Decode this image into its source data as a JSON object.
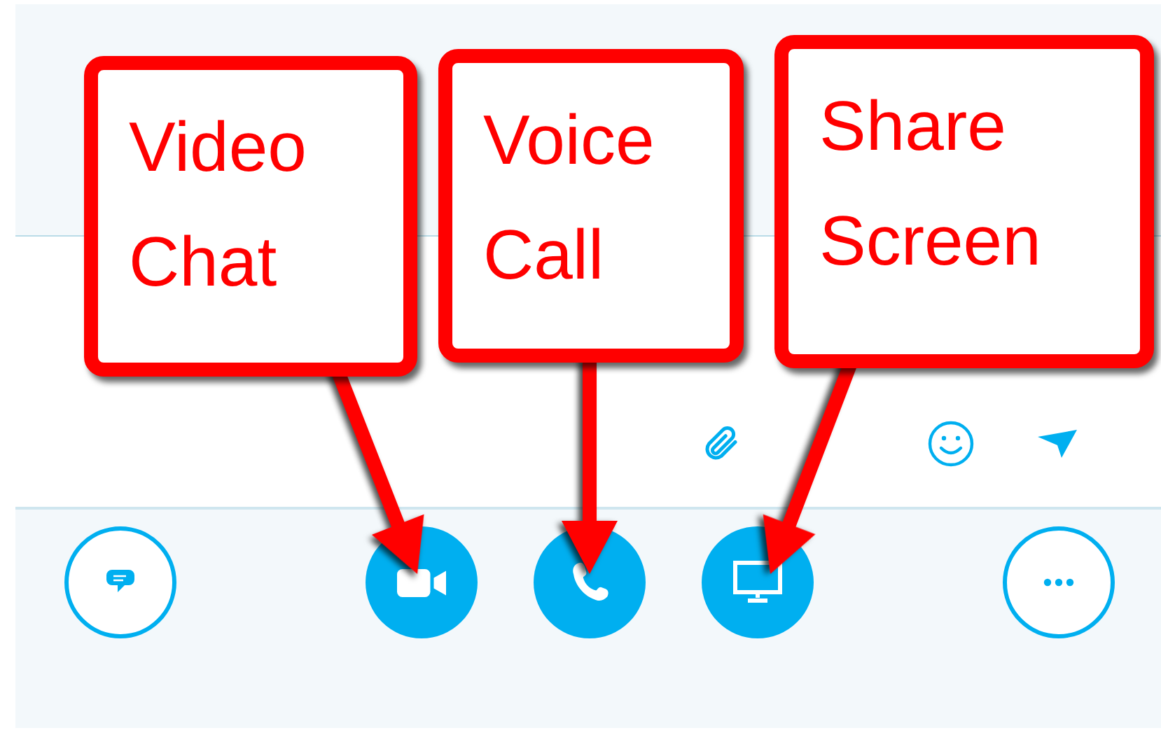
{
  "callouts": [
    {
      "text": "Video Chat"
    },
    {
      "text": "Voice Call"
    },
    {
      "text": "Share Screen"
    }
  ],
  "compose_tools": [
    {
      "kind": "attach"
    },
    {
      "kind": "emoji"
    },
    {
      "kind": "send"
    }
  ],
  "call_buttons": [
    {
      "kind": "chat"
    },
    {
      "kind": "video"
    },
    {
      "kind": "call"
    },
    {
      "kind": "screen"
    },
    {
      "kind": "more"
    }
  ]
}
